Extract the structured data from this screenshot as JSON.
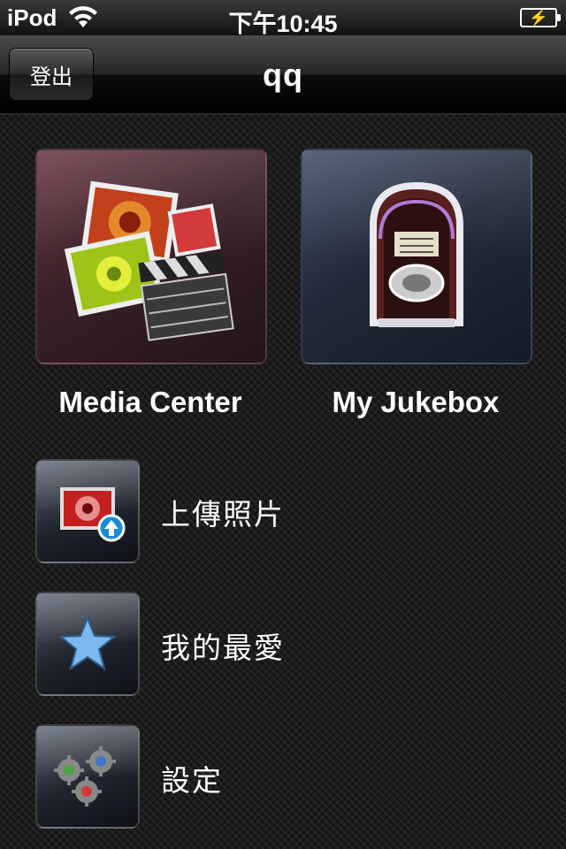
{
  "status_bar": {
    "carrier": "iPod",
    "time": "下午10:45"
  },
  "nav": {
    "back_label": "登出",
    "title": "qq"
  },
  "tiles": [
    {
      "label": "Media Center",
      "icon": "photos-clapperboard-icon"
    },
    {
      "label": "My Jukebox",
      "icon": "jukebox-icon"
    }
  ],
  "menu": [
    {
      "label": "上傳照片",
      "icon": "upload-photo-icon"
    },
    {
      "label": "我的最愛",
      "icon": "star-icon"
    },
    {
      "label": "設定",
      "icon": "gears-icon"
    }
  ],
  "colors": {
    "background": "#1b1b1b",
    "media_tile": "#6b3a47",
    "jukebox_tile": "#40506a",
    "upload_badge": "#1a8bd6",
    "star": "#7ab8ee"
  }
}
